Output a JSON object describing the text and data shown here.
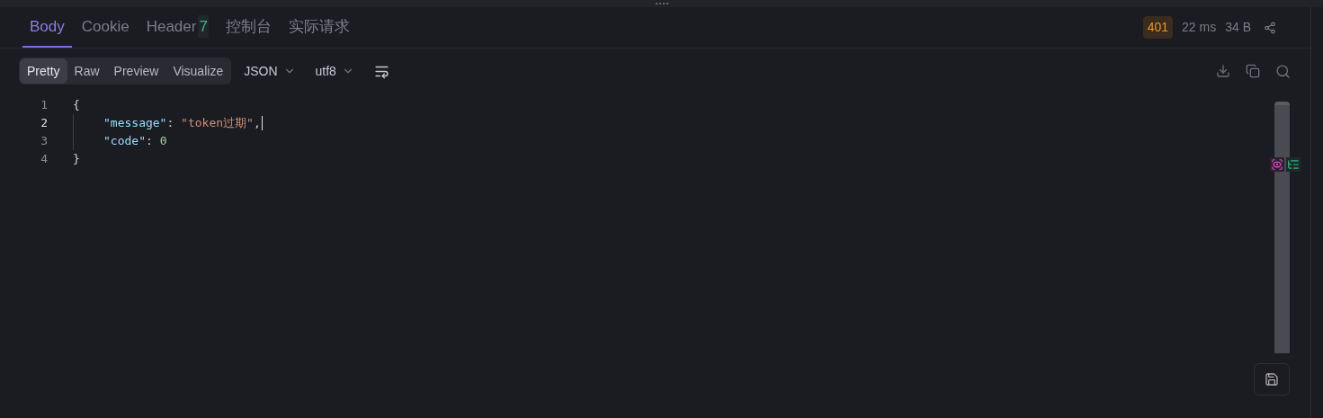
{
  "tabs": [
    {
      "label": "Body",
      "selected": true
    },
    {
      "label": "Cookie",
      "selected": false
    },
    {
      "label": "Header",
      "count": "7",
      "selected": false
    },
    {
      "label": "控制台",
      "selected": false
    },
    {
      "label": "实际请求",
      "selected": false
    }
  ],
  "response_meta": {
    "status": "401",
    "time": "22 ms",
    "size": "34 B"
  },
  "view_modes": [
    {
      "label": "Pretty",
      "selected": true
    },
    {
      "label": "Raw",
      "selected": false
    },
    {
      "label": "Preview",
      "selected": false
    },
    {
      "label": "Visualize",
      "selected": false
    }
  ],
  "format_dropdown": "JSON",
  "encoding_dropdown": "utf8",
  "code_lines": [
    {
      "number": "1",
      "active": false,
      "indent": false,
      "tokens": [
        {
          "kind": "punct",
          "text": "{"
        }
      ]
    },
    {
      "number": "2",
      "active": true,
      "indent": true,
      "tokens": [
        {
          "kind": "key",
          "text": "\"message\""
        },
        {
          "kind": "punct",
          "text": ": "
        },
        {
          "kind": "string",
          "text": "\"token过期\""
        },
        {
          "kind": "punct",
          "text": ","
        }
      ]
    },
    {
      "number": "3",
      "active": false,
      "indent": true,
      "tokens": [
        {
          "kind": "key",
          "text": "\"code\""
        },
        {
          "kind": "punct",
          "text": ": "
        },
        {
          "kind": "number",
          "text": "0"
        }
      ]
    },
    {
      "number": "4",
      "active": false,
      "indent": false,
      "tokens": [
        {
          "kind": "punct",
          "text": "}"
        }
      ]
    }
  ]
}
